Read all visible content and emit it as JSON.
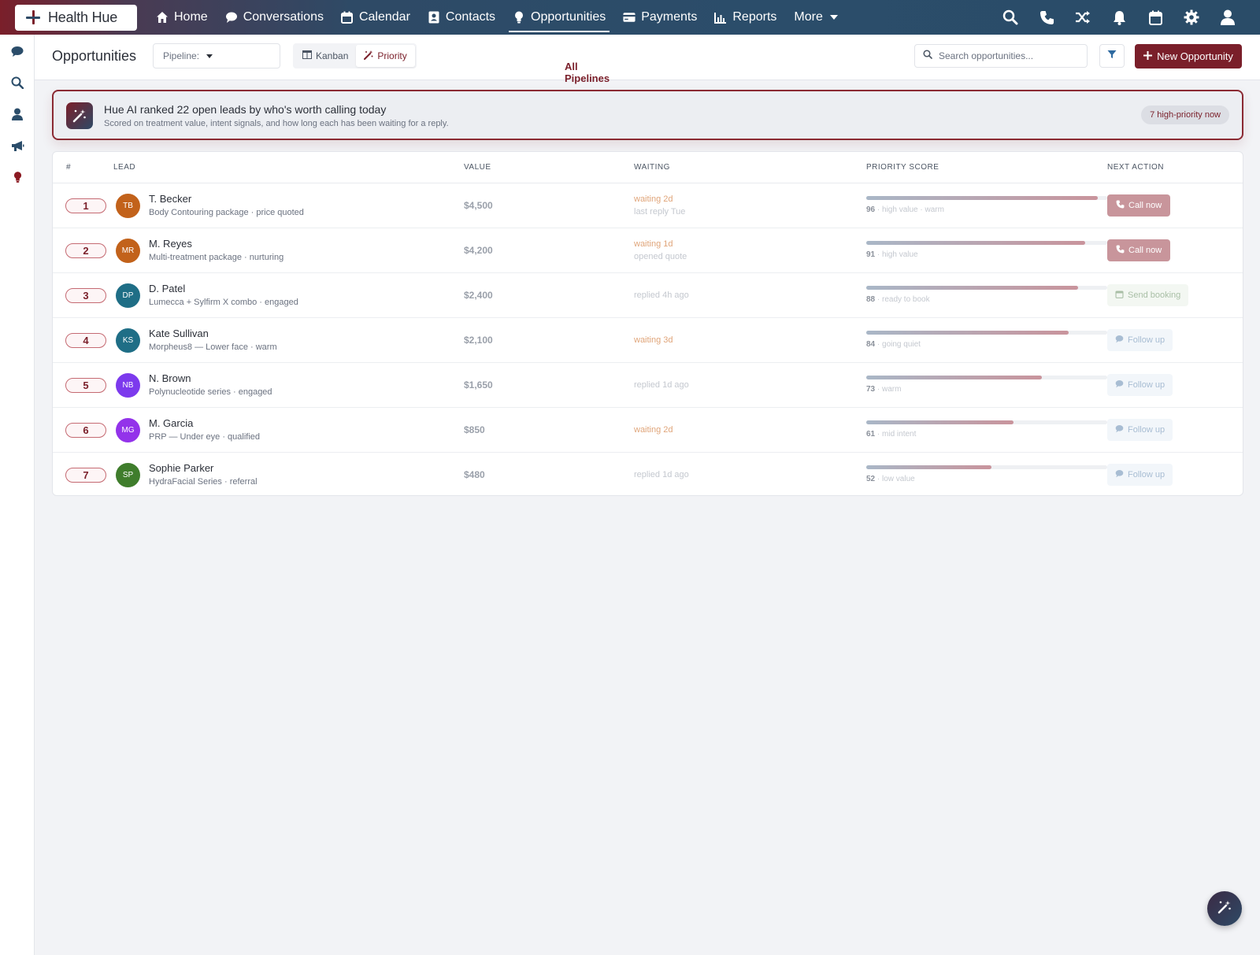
{
  "app": {
    "brand": "Health Hue"
  },
  "nav": {
    "items": [
      {
        "label": "Home",
        "icon": "home-icon"
      },
      {
        "label": "Conversations",
        "icon": "chat-icon"
      },
      {
        "label": "Calendar",
        "icon": "calendar-icon"
      },
      {
        "label": "Contacts",
        "icon": "contact-card-icon"
      },
      {
        "label": "Opportunities",
        "icon": "lightbulb-icon",
        "active": true
      },
      {
        "label": "Payments",
        "icon": "credit-card-icon"
      },
      {
        "label": "Reports",
        "icon": "bar-chart-icon"
      },
      {
        "label": "More",
        "icon": "chevron-down-icon"
      }
    ],
    "right_icons": [
      "search-icon",
      "phone-icon",
      "shuffle-icon",
      "bell-icon",
      "calendar-icon",
      "gear-icon",
      "user-icon"
    ]
  },
  "rail": {
    "icons": [
      "chat-icon",
      "search-icon",
      "user-icon",
      "megaphone-icon",
      "lightbulb-icon"
    ]
  },
  "subheader": {
    "title": "Opportunities",
    "pipeline_label": "Pipeline:",
    "pipeline_value": "All Pipelines",
    "views": [
      {
        "label": "Kanban"
      },
      {
        "label": "Priority",
        "active": true
      }
    ],
    "search_placeholder": "Search opportunities...",
    "new_button": "New Opportunity"
  },
  "banner": {
    "title": "Hue AI ranked 22 open leads by who's worth calling today",
    "subtitle": "Scored on treatment value, intent signals, and how long each has been waiting for a reply.",
    "pill": "7 high-priority now"
  },
  "table": {
    "columns": [
      "#",
      "Lead",
      "Value",
      "Waiting",
      "Priority score",
      "Next action"
    ],
    "rows": [
      {
        "rank": "1",
        "initials": "TB",
        "avatar_color": "#c2621b",
        "name": "T. Becker",
        "detail": "Body Contouring package · price quoted",
        "value": "$4,500",
        "waiting": "waiting 2d",
        "waiting_note": "last reply Tue",
        "waiting_style": "warn",
        "score": 96,
        "score_label": "96",
        "score_note": "high value · warm",
        "action": "Call now",
        "action_type": "call"
      },
      {
        "rank": "2",
        "initials": "MR",
        "avatar_color": "#c2621b",
        "name": "M. Reyes",
        "detail": "Multi-treatment package · nurturing",
        "value": "$4,200",
        "waiting": "waiting 1d",
        "waiting_note": "opened quote",
        "waiting_style": "warn",
        "score": 91,
        "score_label": "91",
        "score_note": "high value",
        "action": "Call now",
        "action_type": "call"
      },
      {
        "rank": "3",
        "initials": "DP",
        "avatar_color": "#1f6e86",
        "name": "D. Patel",
        "detail": "Lumecca + Sylfirm X combo · engaged",
        "value": "$2,400",
        "waiting": "replied 4h ago",
        "waiting_note": "",
        "waiting_style": "muted",
        "score": 88,
        "score_label": "88",
        "score_note": "ready to book",
        "action": "Send booking",
        "action_type": "booking"
      },
      {
        "rank": "4",
        "initials": "KS",
        "avatar_color": "#1f6e86",
        "name": "Kate Sullivan",
        "detail": "Morpheus8 — Lower face · warm",
        "value": "$2,100",
        "waiting": "waiting 3d",
        "waiting_note": "",
        "waiting_style": "warn",
        "score": 84,
        "score_label": "84",
        "score_note": "going quiet",
        "action": "Follow up",
        "action_type": "follow"
      },
      {
        "rank": "5",
        "initials": "NB",
        "avatar_color": "#7c3aed",
        "name": "N. Brown",
        "detail": "Polynucleotide series · engaged",
        "value": "$1,650",
        "waiting": "replied 1d ago",
        "waiting_note": "",
        "waiting_style": "muted",
        "score": 73,
        "score_label": "73",
        "score_note": "warm",
        "action": "Follow up",
        "action_type": "follow"
      },
      {
        "rank": "6",
        "initials": "MG",
        "avatar_color": "#9333ea",
        "name": "M. Garcia",
        "detail": "PRP — Under eye · qualified",
        "value": "$850",
        "waiting": "waiting 2d",
        "waiting_note": "",
        "waiting_style": "warn",
        "score": 61,
        "score_label": "61",
        "score_note": "mid intent",
        "action": "Follow up",
        "action_type": "follow"
      },
      {
        "rank": "7",
        "initials": "SP",
        "avatar_color": "#3f7d2c",
        "name": "Sophie Parker",
        "detail": "HydraFacial Series · referral",
        "value": "$480",
        "waiting": "replied 1d ago",
        "waiting_note": "",
        "waiting_style": "muted",
        "score": 52,
        "score_label": "52",
        "score_note": "low value",
        "action": "Follow up",
        "action_type": "follow"
      }
    ]
  },
  "colors": {
    "brand": "#7a1f2a",
    "nav": "#2e4a66",
    "warn": "#e0a57a",
    "muted": "#c4c8cf"
  }
}
